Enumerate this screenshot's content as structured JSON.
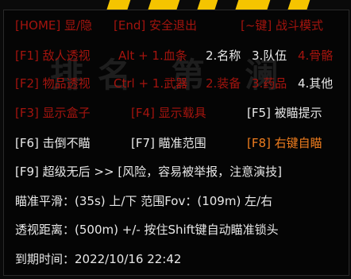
{
  "colors": {
    "off": "#a3140e",
    "on": "#e8e8e8",
    "highlight": "#ef7d1e",
    "banner": "#f5c400"
  },
  "watermark": "排名 第 澜",
  "rows": [
    {
      "segments": [
        {
          "text": "[HOME] 显/隐",
          "state": "off"
        },
        {
          "text": "[End] 安全退出",
          "state": "off"
        },
        {
          "text": "[~键] 战斗模式",
          "state": "off"
        }
      ]
    },
    {
      "segments": [
        {
          "text": "[F1] 敌人透视",
          "state": "off"
        },
        {
          "text": "Alt + 1.血条",
          "state": "off"
        },
        {
          "text": "2.名称",
          "state": "on"
        },
        {
          "text": "3.队伍",
          "state": "on"
        },
        {
          "text": "4.骨骼",
          "state": "off"
        }
      ]
    },
    {
      "segments": [
        {
          "text": "[F2] 物品透视",
          "state": "off"
        },
        {
          "text": "Ctrl + 1.武器",
          "state": "off"
        },
        {
          "text": "2.装备",
          "state": "off"
        },
        {
          "text": "3.药品",
          "state": "off"
        },
        {
          "text": "4.其他",
          "state": "on"
        }
      ]
    },
    {
      "segments": [
        {
          "text": "[F3] 显示盒子",
          "state": "off"
        },
        {
          "text": "[F4] 显示载具",
          "state": "off"
        },
        {
          "text": "[F5] 被瞄提示",
          "state": "on"
        }
      ]
    },
    {
      "segments": [
        {
          "text": "[F6] 击倒不瞄",
          "state": "on"
        },
        {
          "text": "[F7] 瞄准范围",
          "state": "on"
        },
        {
          "text": "[F8] 右键自瞄",
          "state": "highlight"
        }
      ]
    },
    {
      "segments": [
        {
          "text": "[F9] 超级无后 >> [风险，容易被举报，注意演技]",
          "state": "on"
        }
      ]
    },
    {
      "segments": [
        {
          "text": "瞄准平滑：(35s) 上/下  范围Fov：(109m) 左/右",
          "state": "on"
        }
      ]
    },
    {
      "segments": [
        {
          "text": "透视距离：(500m) +/-   按住Shift键自动瞄准锁头",
          "state": "on"
        }
      ]
    },
    {
      "segments": [
        {
          "text": "到期时间：2022/10/16 22:42",
          "state": "on"
        }
      ]
    }
  ]
}
